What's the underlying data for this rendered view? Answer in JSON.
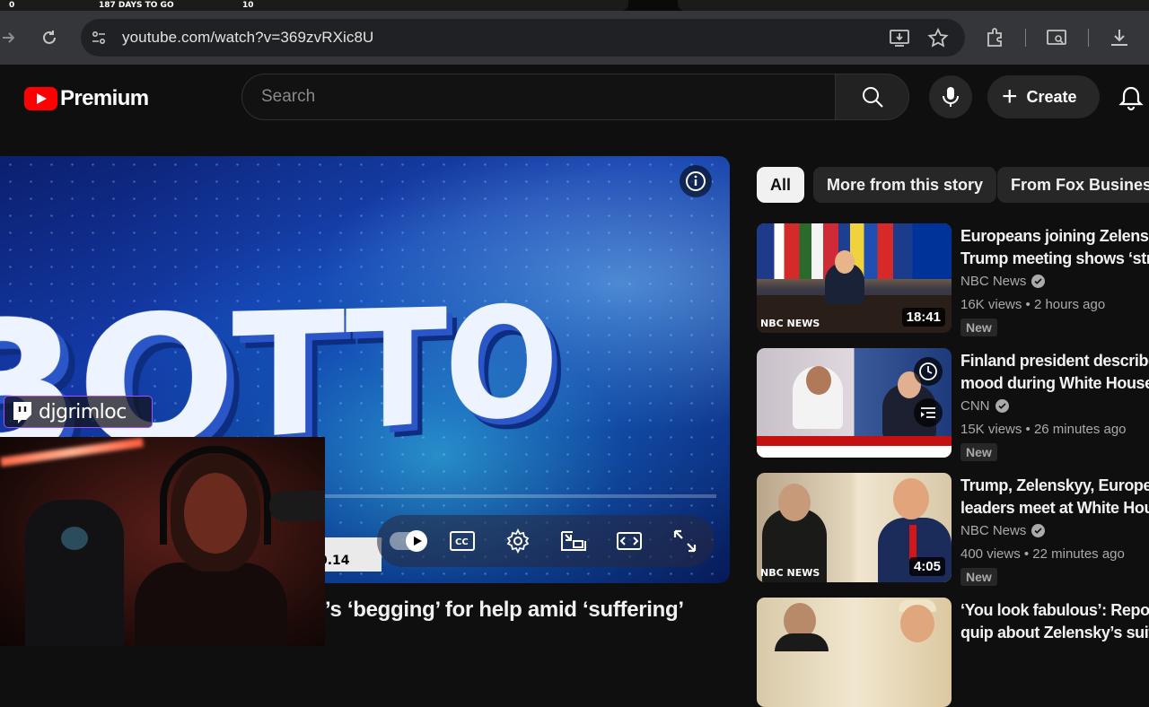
{
  "overlay_strip": {
    "left_num": "0",
    "countdown": "187 DAYS TO GO",
    "right_num": "10"
  },
  "browser": {
    "url": "youtube.com/watch?v=369zvRXic8U"
  },
  "youtube": {
    "logo_word": "Premium",
    "search_placeholder": "Search",
    "create_label": "Create"
  },
  "player": {
    "lower_third_text": "0.14",
    "progress_fraction": 0.0
  },
  "streamer": {
    "twitch_name": "djgrimloc"
  },
  "video": {
    "title_visible": "’s ‘begging’ for help amid ‘suffering’"
  },
  "chips": [
    "All",
    "More from this story",
    "From Fox Business"
  ],
  "recommendations": [
    {
      "title_line1": "Europeans joining Zelensk",
      "title_line2": "Trump meeting shows ‘stre",
      "channel": "NBC News",
      "verified": true,
      "meta": "16K views • 2 hours ago",
      "badge": "New",
      "duration": "18:41",
      "thumb_label": "NBC NEWS"
    },
    {
      "title_line1": "Finland president describe",
      "title_line2": "mood during White House",
      "channel": "CNN",
      "verified": true,
      "meta": "15K views • 26 minutes ago",
      "badge": "New",
      "duration": "",
      "thumb_label": ""
    },
    {
      "title_line1": "Trump, Zelenskyy, Europea",
      "title_line2": "leaders meet at White Hou",
      "channel": "NBC News",
      "verified": true,
      "meta": "400 views • 22 minutes ago",
      "badge": "New",
      "duration": "4:05",
      "thumb_label": "NBC NEWS"
    },
    {
      "title_line1": "‘You look fabulous’: Repor",
      "title_line2": "quip about Zelensky’s suit",
      "channel": "",
      "verified": false,
      "meta": "",
      "badge": "",
      "duration": "",
      "thumb_label": ""
    }
  ],
  "colors": {
    "yt_red": "#ff0000",
    "background": "#0f0f0f",
    "chip_bg": "#272727",
    "secondary_text": "#aaaaaa",
    "twitch_purple": "#a050ff"
  },
  "icons": [
    "back-arrow-icon",
    "reload-icon",
    "site-settings-icon",
    "install-app-icon",
    "star-icon",
    "extensions-icon",
    "tab-search-icon",
    "download-icon",
    "search-icon",
    "mic-icon",
    "bell-icon",
    "info-icon",
    "cc-icon",
    "settings-gear-icon",
    "miniplayer-icon",
    "theater-icon",
    "fullscreen-icon",
    "twitch-icon",
    "verified-check-icon",
    "watch-later-icon",
    "add-to-queue-icon"
  ]
}
